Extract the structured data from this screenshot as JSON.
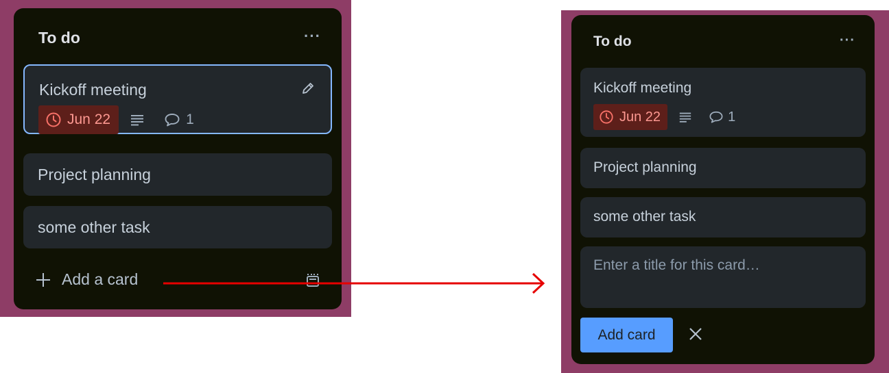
{
  "before": {
    "list_title": "To do",
    "menu": "···",
    "cards": [
      {
        "title": "Kickoff meeting",
        "due": "Jun 22",
        "comments": "1"
      },
      {
        "title": "Project planning"
      },
      {
        "title": "some other task"
      }
    ],
    "add_card_label": "Add a card"
  },
  "after": {
    "list_title": "To do",
    "menu": "···",
    "cards": [
      {
        "title": "Kickoff meeting",
        "due": "Jun 22",
        "comments": "1"
      },
      {
        "title": "Project planning"
      },
      {
        "title": "some other task"
      }
    ],
    "input_placeholder": "Enter a title for this card…",
    "add_button_label": "Add card"
  },
  "colors": {
    "board_background": "#8e3d66",
    "list_background": "#101204",
    "card_background": "#22272b",
    "due_badge_bg": "#5d1f1a",
    "due_badge_text": "#fd9891",
    "selected_border": "#85b8ff",
    "primary_button": "#579dff",
    "arrow": "#e60000"
  }
}
